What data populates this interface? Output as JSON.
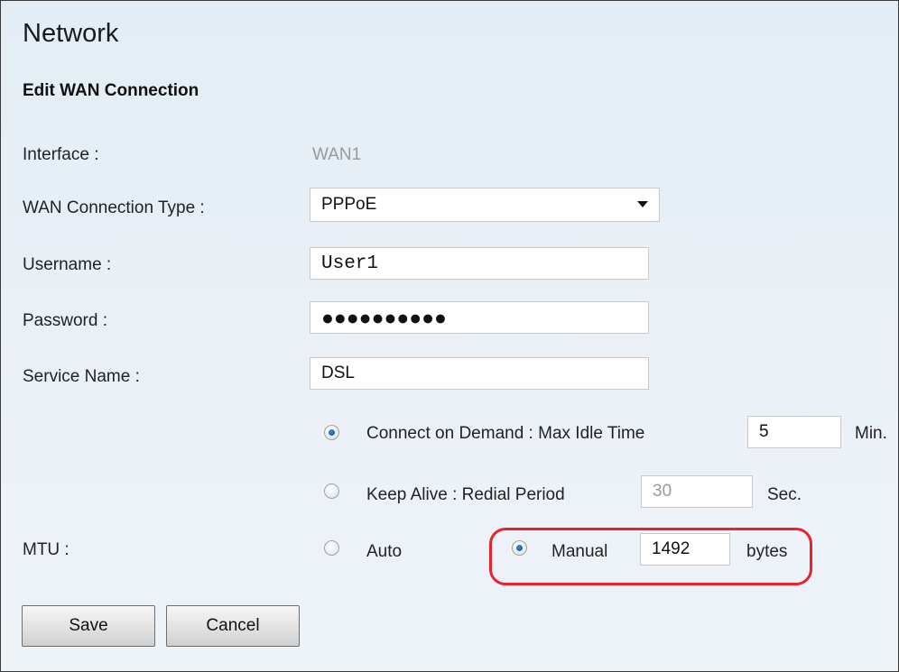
{
  "page": {
    "title": "Network",
    "section_title": "Edit WAN Connection"
  },
  "form": {
    "interface": {
      "label": "Interface :",
      "value": "WAN1"
    },
    "connection_type": {
      "label": "WAN Connection Type :",
      "value": "PPPoE"
    },
    "username": {
      "label": "Username :",
      "value": "User1"
    },
    "password": {
      "label": "Password :",
      "value": "●●●●●●●●●●"
    },
    "service_name": {
      "label": "Service Name :",
      "value": "DSL"
    },
    "connect_on_demand": {
      "label": "Connect on Demand : Max Idle Time",
      "value": "5",
      "unit": "Min.",
      "selected": true
    },
    "keep_alive": {
      "label": "Keep Alive : Redial Period",
      "value": "30",
      "unit": "Sec.",
      "selected": false
    },
    "mtu": {
      "label": "MTU :",
      "auto_label": "Auto",
      "auto_selected": false,
      "manual_label": "Manual",
      "manual_selected": true,
      "value": "1492",
      "unit": "bytes"
    }
  },
  "buttons": {
    "save": "Save",
    "cancel": "Cancel"
  },
  "colors": {
    "highlight": "#e8232a",
    "radio_selected": "#1c4f93",
    "background": "#e6eef5"
  }
}
